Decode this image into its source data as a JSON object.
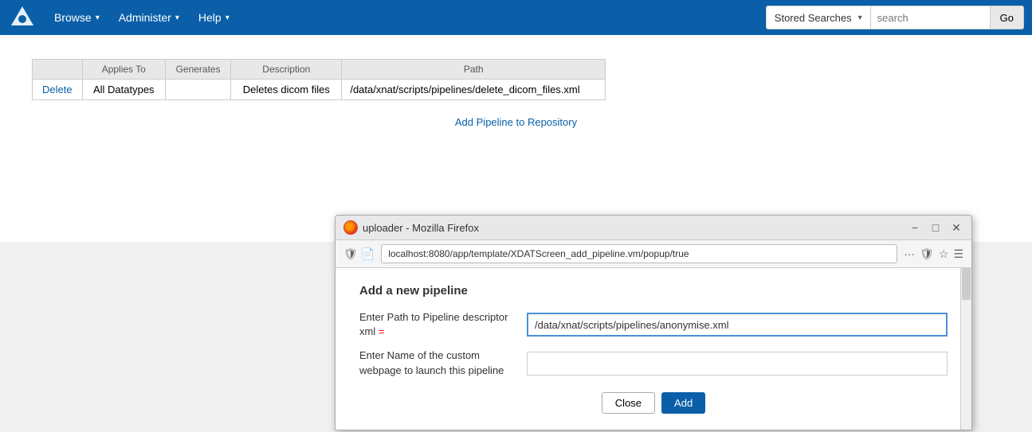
{
  "navbar": {
    "browse_label": "Browse",
    "administer_label": "Administer",
    "help_label": "Help",
    "stored_searches_label": "Stored Searches",
    "search_placeholder": "search",
    "go_label": "Go"
  },
  "table": {
    "columns": [
      "",
      "Applies To",
      "Generates",
      "Description",
      "Path"
    ],
    "rows": [
      {
        "action": "Delete",
        "applies_to": "All Datatypes",
        "generates": "",
        "description": "Deletes dicom files",
        "path": "/data/xnat/scripts/pipelines/delete_dicom_files.xml"
      }
    ],
    "add_pipeline_link": "Add Pipeline to Repository"
  },
  "browser": {
    "title": "uploader - Mozilla Firefox",
    "url": "localhost:8080/app/template/XDATScreen_add_pipeline.vm/popup/true",
    "controls": {
      "minimize": "−",
      "maximize": "□",
      "close": "✕"
    },
    "popup": {
      "title": "Add a new pipeline",
      "path_label": "Enter Path to Pipeline descriptor xml",
      "path_required": "=",
      "path_value": "/data/xnat/scripts/pipelines/anonymise.xml",
      "name_label": "Enter Name of the custom webpage to launch this pipeline",
      "name_value": "",
      "close_btn": "Close",
      "add_btn": "Add"
    }
  }
}
